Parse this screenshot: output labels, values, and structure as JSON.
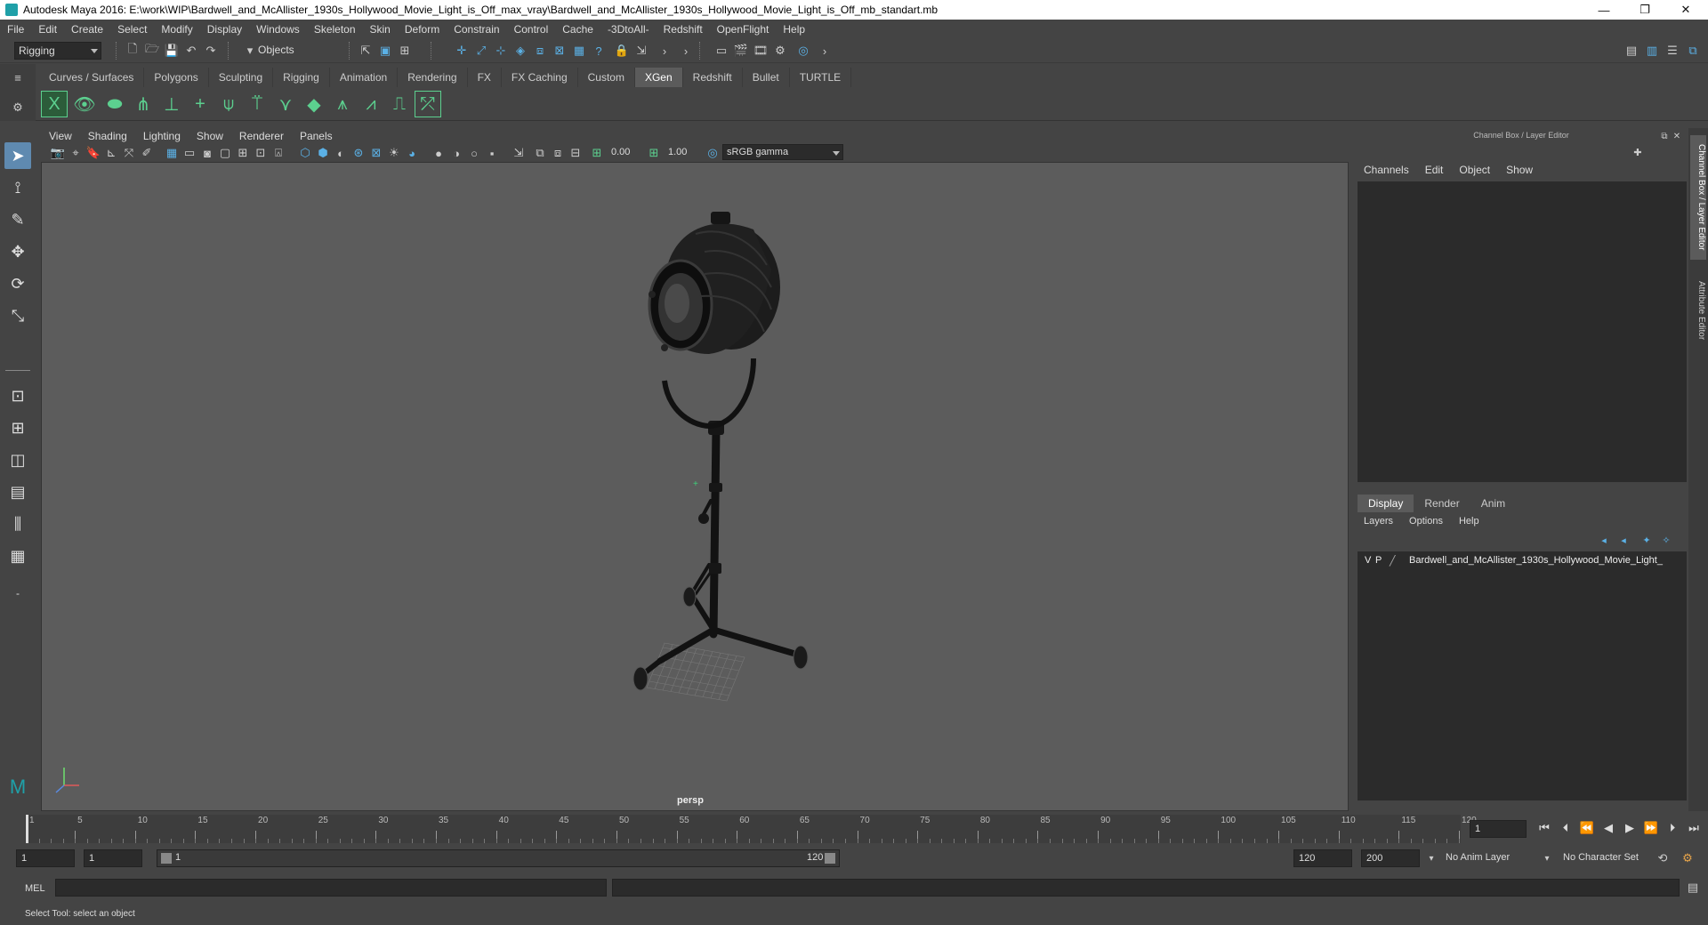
{
  "window": {
    "title": "Autodesk Maya 2016: E:\\work\\WIP\\Bardwell_and_McAllister_1930s_Hollywood_Movie_Light_is_Off_max_vray\\Bardwell_and_McAllister_1930s_Hollywood_Movie_Light_is_Off_mb_standart.mb",
    "controls": {
      "minimize": "—",
      "restore": "❐",
      "close": "✕"
    }
  },
  "menubar": [
    "File",
    "Edit",
    "Create",
    "Select",
    "Modify",
    "Display",
    "Windows",
    "Skeleton",
    "Skin",
    "Deform",
    "Constrain",
    "Control",
    "Cache",
    "-3DtoAll-",
    "Redshift",
    "OpenFlight",
    "Help"
  ],
  "statusline": {
    "menuset": "Rigging",
    "selection_mode": "Objects"
  },
  "shelf": {
    "tabs": [
      "Curves / Surfaces",
      "Polygons",
      "Sculpting",
      "Rigging",
      "Animation",
      "Rendering",
      "FX",
      "FX Caching",
      "Custom",
      "XGen",
      "Redshift",
      "Bullet",
      "TURTLE"
    ],
    "active_tab": "XGen"
  },
  "viewport": {
    "menu": [
      "View",
      "Shading",
      "Lighting",
      "Show",
      "Renderer",
      "Panels"
    ],
    "exposure": "0.00",
    "gamma": "1.00",
    "color_space": "sRGB gamma",
    "camera": "persp"
  },
  "channel_box": {
    "header": "Channel Box / Layer Editor",
    "menu": [
      "Channels",
      "Edit",
      "Object",
      "Show"
    ]
  },
  "layer_editor": {
    "tabs": [
      "Display",
      "Render",
      "Anim"
    ],
    "active_tab": "Display",
    "menu": [
      "Layers",
      "Options",
      "Help"
    ],
    "layers": [
      {
        "v": "V",
        "p": "P",
        "name": "Bardwell_and_McAllister_1930s_Hollywood_Movie_Light_"
      }
    ]
  },
  "side_tabs": [
    "Channel Box / Layer Editor",
    "Attribute Editor"
  ],
  "timeline": {
    "ticks": [
      "1",
      "5",
      "10",
      "15",
      "20",
      "25",
      "30",
      "35",
      "40",
      "45",
      "50",
      "55",
      "60",
      "65",
      "70",
      "75",
      "80",
      "85",
      "90",
      "95",
      "100",
      "105",
      "110",
      "115",
      "120"
    ],
    "current_frame": "1"
  },
  "range": {
    "start": "1",
    "playback_start": "1",
    "range_start": "1",
    "range_end": "120",
    "playback_end": "120",
    "end": "200",
    "anim_layer": "No Anim Layer",
    "character_set": "No Character Set"
  },
  "command_line": {
    "label": "MEL"
  },
  "help_line": "Select Tool: select an object",
  "colors": {
    "accent": "#5bb1e6",
    "xgen_green": "#5cd08f",
    "viewport_bg": "#5c5c5c"
  }
}
